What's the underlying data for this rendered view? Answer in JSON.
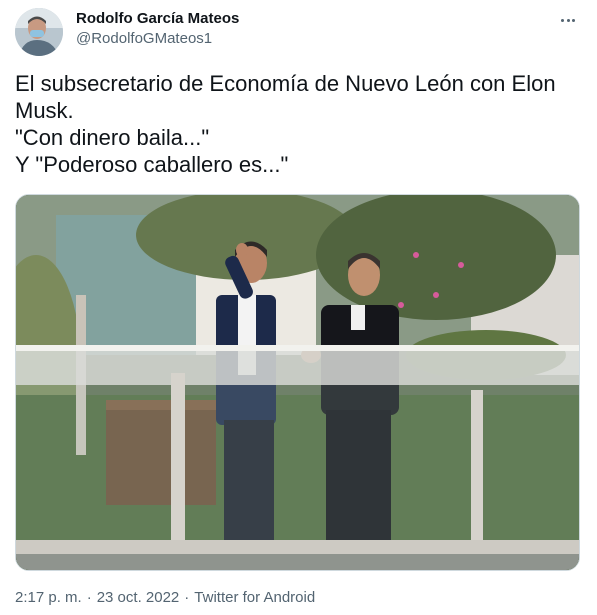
{
  "tweet": {
    "author": {
      "display_name": "Rodolfo García Mateos",
      "handle": "@RodolfoGMateos1",
      "avatar_icon": "profile-photo"
    },
    "more_icon": "ellipsis-icon",
    "text_lines": [
      "El subsecretario de Economía de Nuevo León con Elon",
      "Musk.",
      "\"Con dinero baila...\"",
      "Y \"Poderoso caballero es...\""
    ],
    "media": {
      "type": "photo"
    },
    "timestamp": {
      "time": "2:17 p. m.",
      "separator": "·",
      "date": "23 oct. 2022",
      "source": "Twitter for Android"
    }
  },
  "colors": {
    "primary_text": "#0f1419",
    "secondary_text": "#536471",
    "border": "#cfd9de"
  }
}
